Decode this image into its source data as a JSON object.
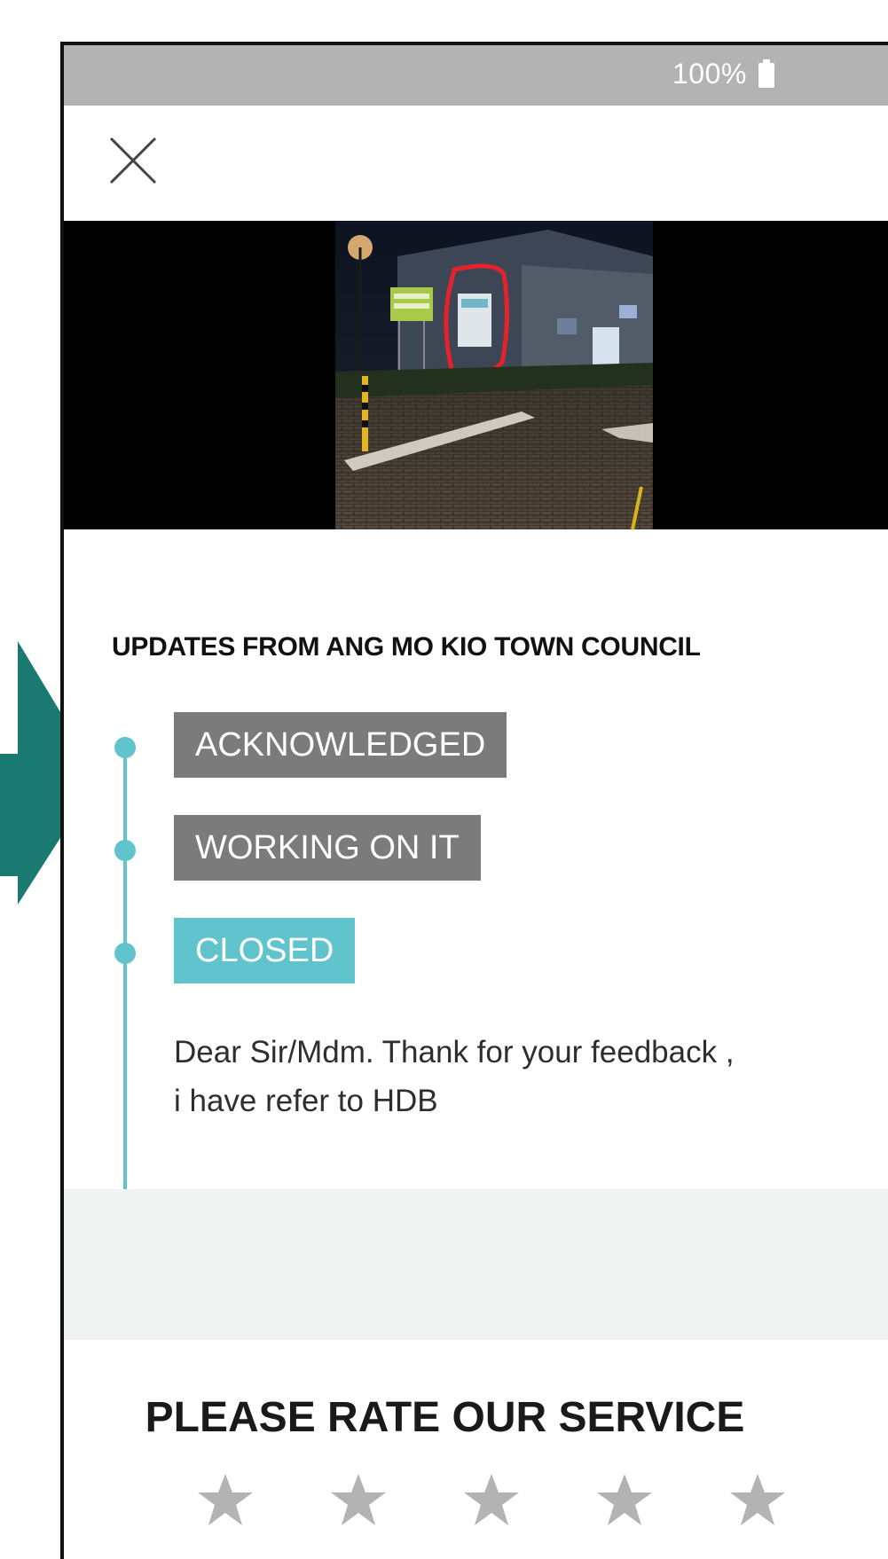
{
  "status_bar": {
    "battery_text": "100%"
  },
  "toolbar": {
    "close_icon": "close-icon"
  },
  "updates": {
    "heading": "UPDATES FROM ANG MO KIO TOWN COUNCIL",
    "steps": [
      {
        "label": "ACKNOWLEDGED",
        "color": "#7b7b7b"
      },
      {
        "label": "WORKING ON IT",
        "color": "#7b7b7b"
      },
      {
        "label": "CLOSED",
        "color": "#61c3cc"
      }
    ],
    "reply_line_1": "Dear Sir/Mdm. Thank for your feedback ,",
    "reply_line_2": "i have refer to HDB"
  },
  "rating": {
    "heading": "PLEASE RATE OUR SERVICE",
    "star_count": 5,
    "star_color": "#b3b3b3"
  },
  "colors": {
    "accent": "#61c3cc",
    "arrow": "#1a7a71"
  }
}
